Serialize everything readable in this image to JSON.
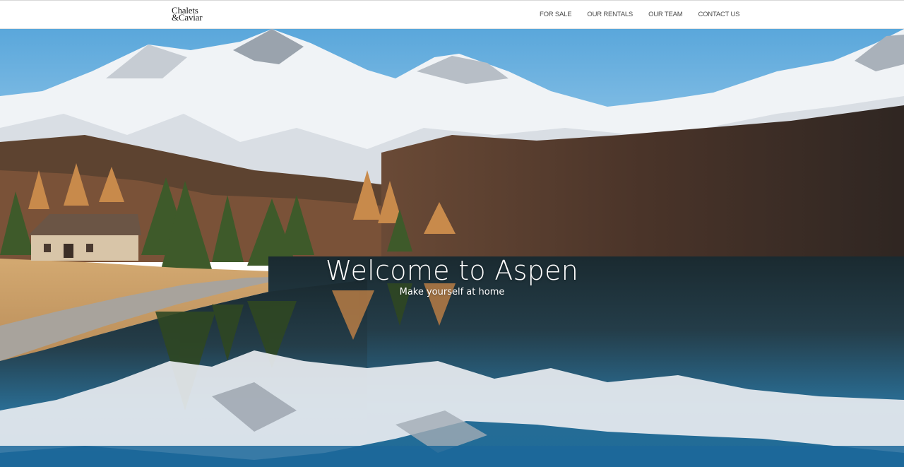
{
  "header": {
    "logo_line1": "Chalets",
    "logo_line2": "&Caviar"
  },
  "nav": {
    "items": [
      {
        "label": "FOR SALE"
      },
      {
        "label": "OUR RENTALS"
      },
      {
        "label": "OUR TEAM"
      },
      {
        "label": "CONTACT US"
      }
    ]
  },
  "hero": {
    "title": "Welcome to Aspen",
    "subtitle": "Make yourself at home"
  },
  "colors": {
    "sky": "#6fb2de",
    "snow": "#f2f5f8",
    "forest": "#3b2b22",
    "lake": "#1f6f9a",
    "meadow": "#c9a06a",
    "text": "#ffffff"
  }
}
